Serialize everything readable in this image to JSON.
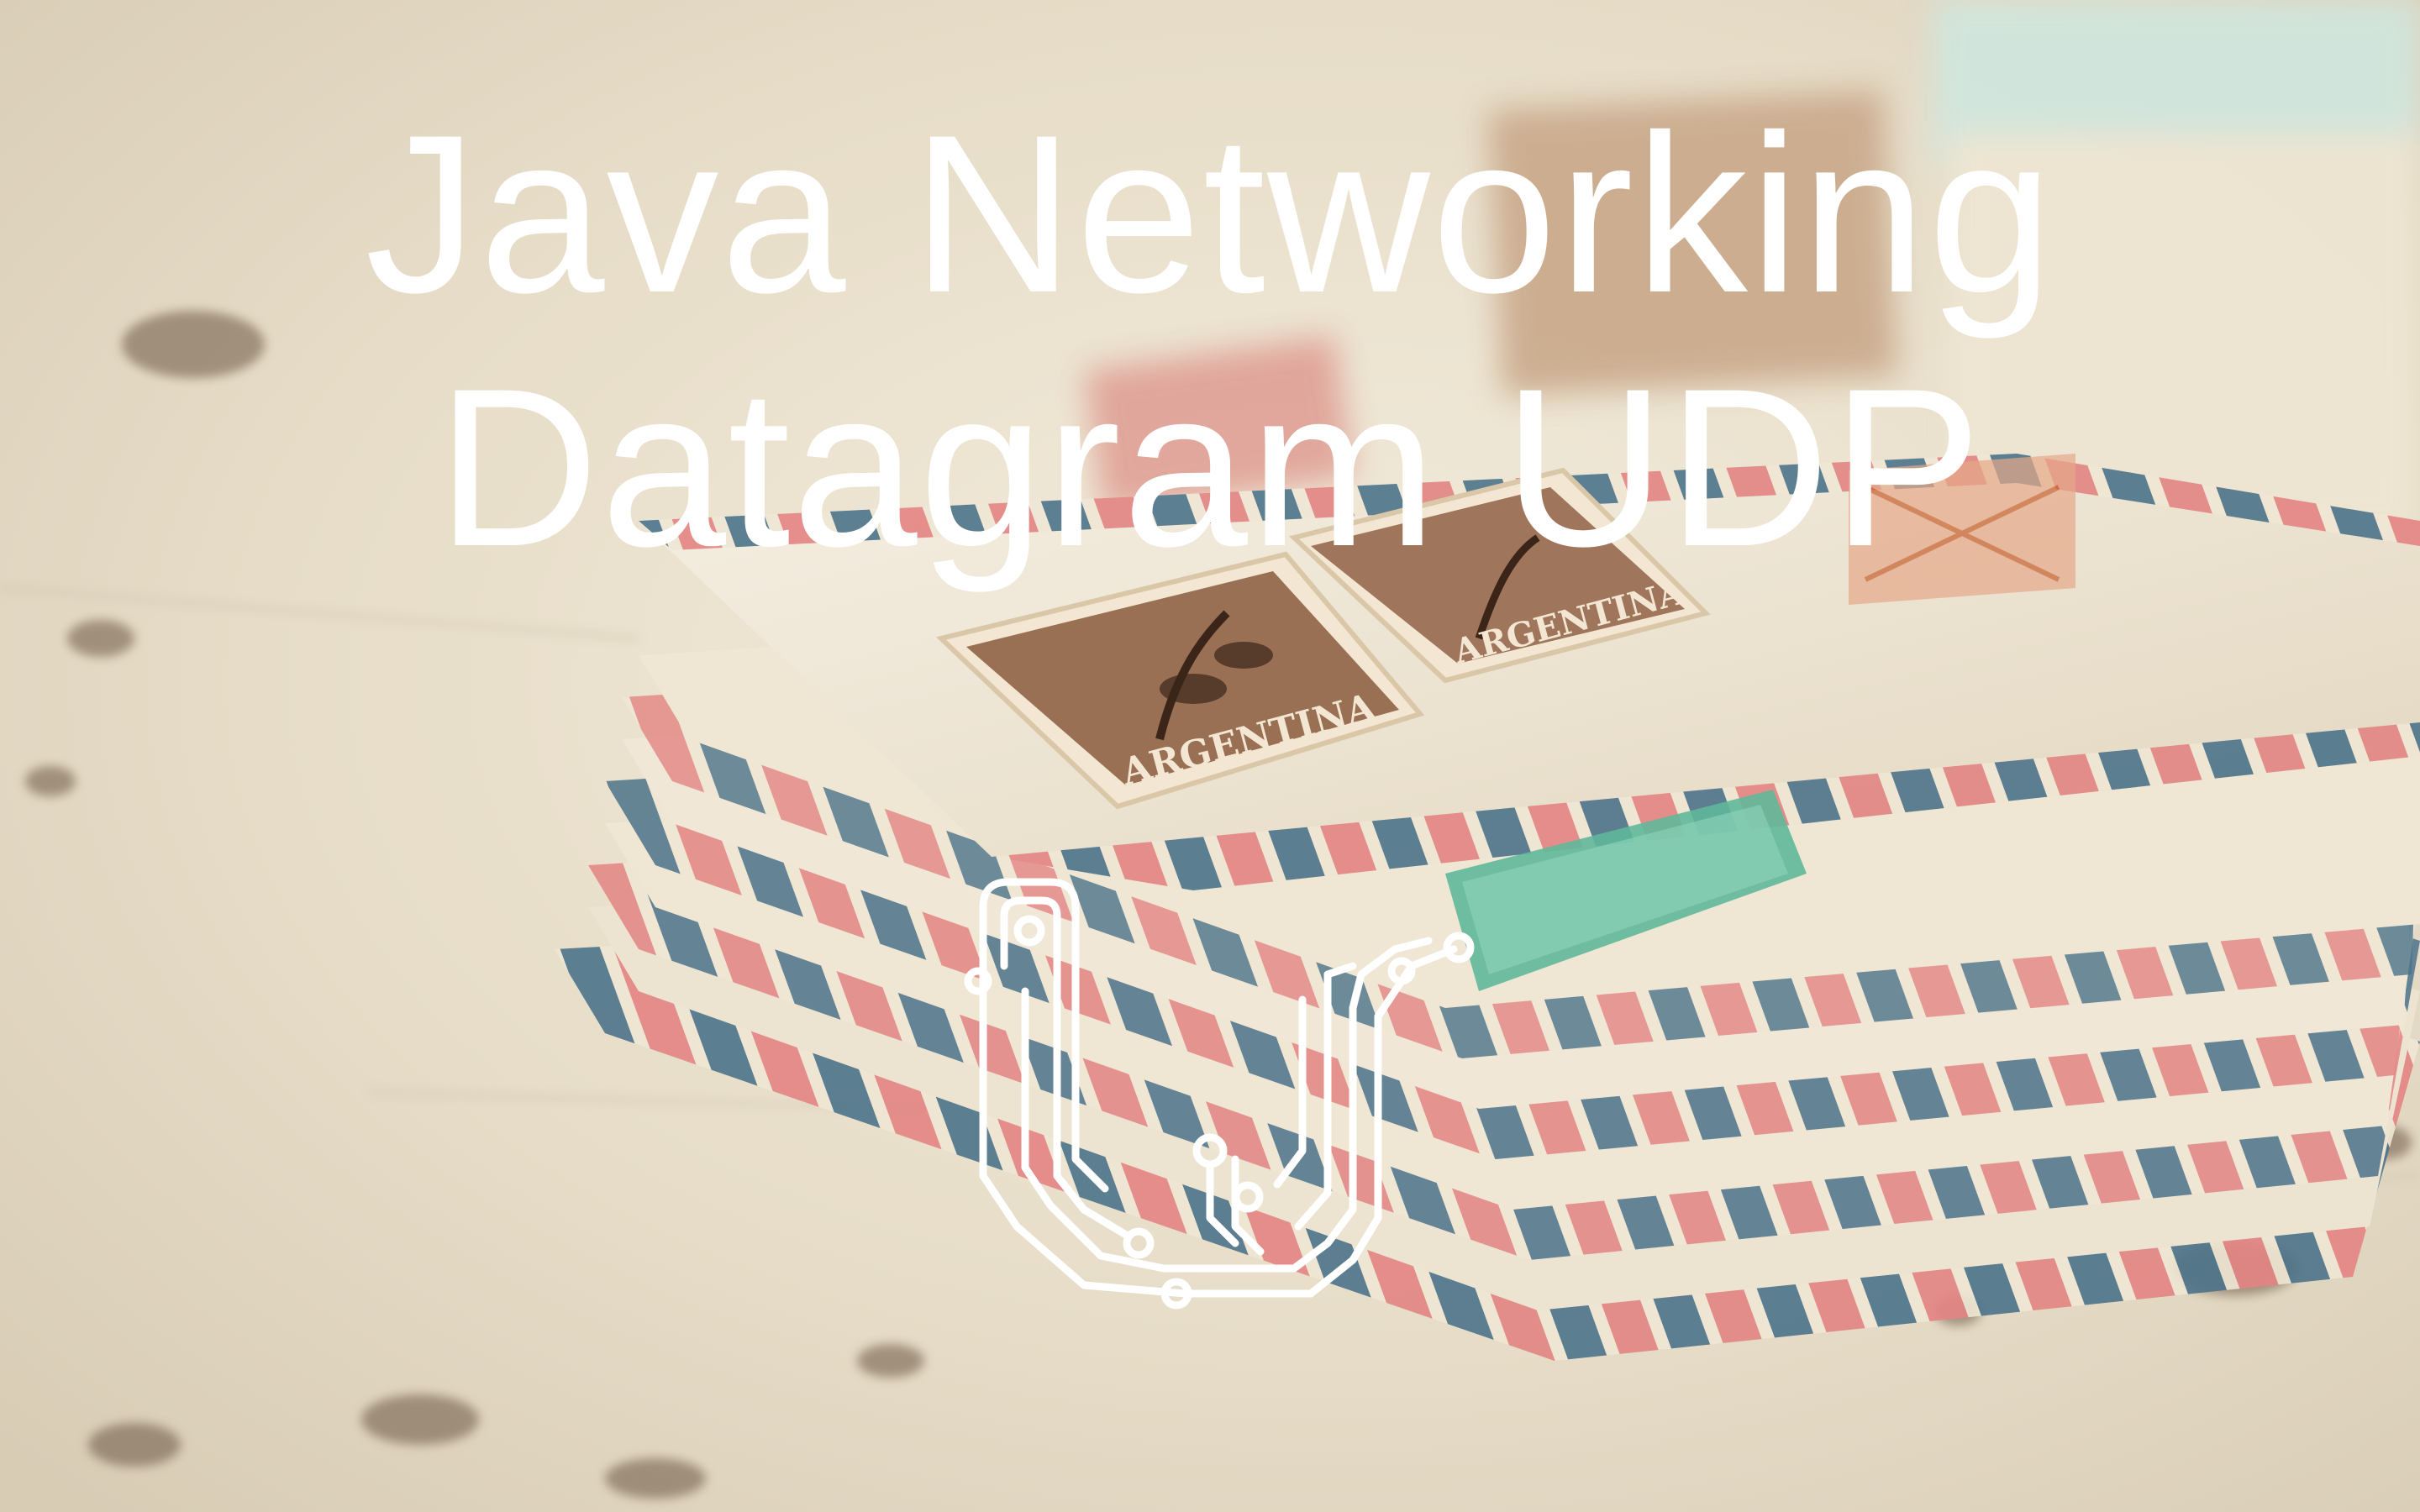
{
  "image": {
    "description_subject": "stack of vintage airmail envelopes with stamps",
    "title_lines": [
      "Java Networking",
      "Datagram UDP"
    ],
    "stamp_text": [
      "ARGENTINA",
      "ARGENTINA"
    ],
    "logo": {
      "icon": "circuit-letter-u-icon",
      "color": "#ffffff"
    },
    "colors": {
      "background": "#e9dfcc",
      "envelope": "#f1eadb",
      "airmail_blue": "#2f5f7d",
      "airmail_red": "#d8323f",
      "stamp_brown": "#8a5a3e",
      "stamp_green": "#5fb89a",
      "title": "#ffffff"
    }
  }
}
